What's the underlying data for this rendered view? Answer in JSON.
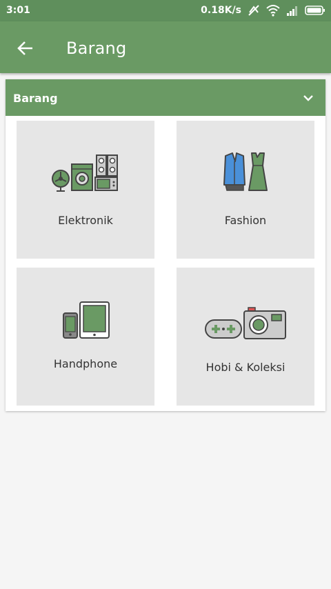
{
  "status_bar": {
    "time": "3:01",
    "speed": "0.18K/s"
  },
  "app_bar": {
    "title": "Barang",
    "back_icon": "arrow-left-icon"
  },
  "card": {
    "title": "Barang",
    "toggle_icon": "chevron-down-icon"
  },
  "categories": [
    {
      "label": "Elektronik",
      "icon": "electronics-icon"
    },
    {
      "label": "Fashion",
      "icon": "fashion-icon"
    },
    {
      "label": "Handphone",
      "icon": "handphone-icon"
    },
    {
      "label": "Hobi & Koleksi",
      "icon": "hobby-collection-icon"
    }
  ],
  "colors": {
    "status_bar": "#5f8f5c",
    "primary": "#6a9a64",
    "icon_green": "#6a9a64",
    "tile_bg": "#e6e6e6",
    "background": "#f5f5f5"
  }
}
